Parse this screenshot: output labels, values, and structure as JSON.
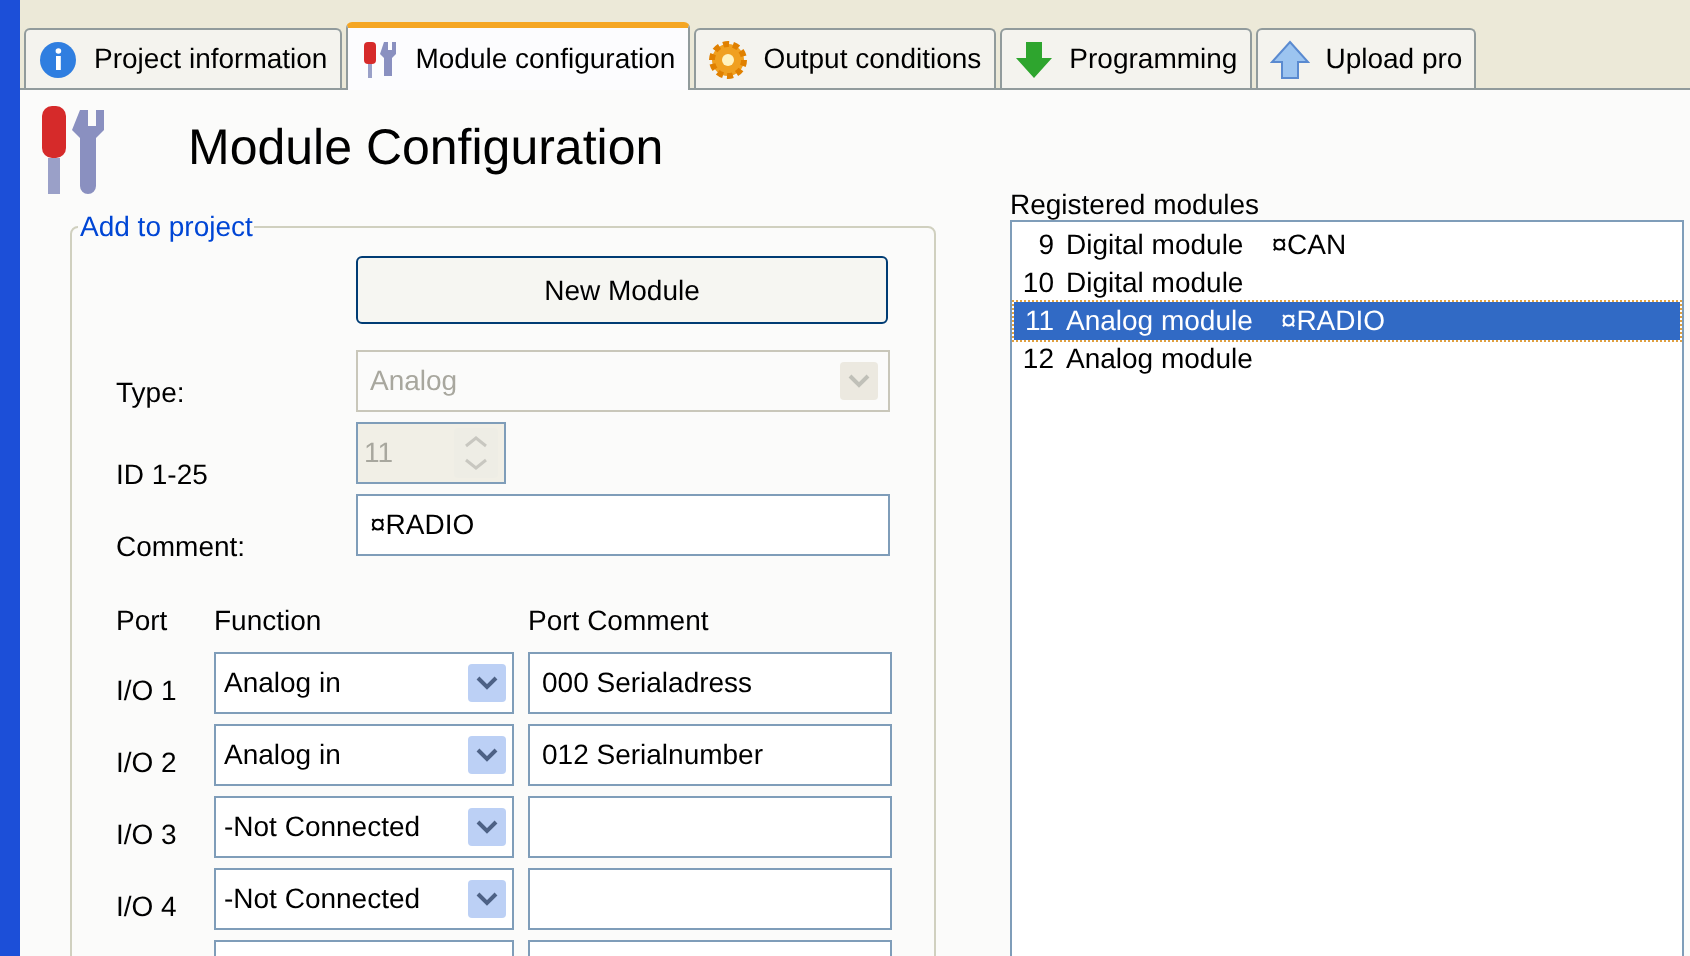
{
  "tabs": [
    {
      "label": "Project information",
      "kind": "info",
      "selected": false
    },
    {
      "label": "Module configuration",
      "kind": "tools",
      "selected": true
    },
    {
      "label": "Output conditions",
      "kind": "gear",
      "selected": false
    },
    {
      "label": "Programming",
      "kind": "down",
      "selected": false
    },
    {
      "label": "Upload pro",
      "kind": "up",
      "selected": false
    }
  ],
  "title": "Module Configuration",
  "add_to_project": {
    "legend": "Add to project",
    "new_button": "New Module",
    "type": {
      "label": "Type:",
      "value": "Analog",
      "disabled": true
    },
    "id": {
      "label": "ID 1-25",
      "value": "11",
      "disabled": true
    },
    "comment": {
      "label": "Comment:",
      "value": "¤RADIO"
    },
    "port_headers": {
      "port": "Port",
      "function": "Function",
      "comment": "Port Comment"
    },
    "ports": [
      {
        "port": "I/O 1",
        "function": "Analog in",
        "comment": "000 Serialadress"
      },
      {
        "port": "I/O 2",
        "function": "Analog in",
        "comment": "012 Serialnumber"
      },
      {
        "port": "I/O 3",
        "function": "-Not Connected"
      },
      {
        "port": "I/O 4",
        "function": "-Not Connected"
      }
    ]
  },
  "registered_modules": {
    "label": "Registered modules",
    "items": [
      {
        "number": "9",
        "name": "Digital module",
        "comment": "¤CAN",
        "selected": false
      },
      {
        "number": "10",
        "name": "Digital module",
        "selected": false
      },
      {
        "number": "11",
        "name": "Analog module",
        "comment": "¤RADIO",
        "selected": true
      },
      {
        "number": "12",
        "name": "Analog module",
        "selected": false
      }
    ]
  }
}
